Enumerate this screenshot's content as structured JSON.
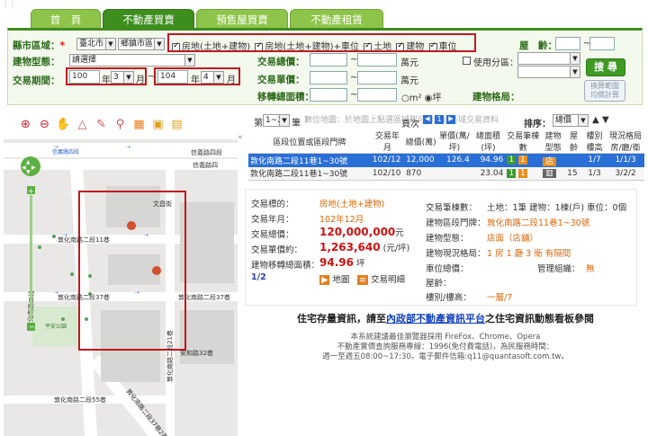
{
  "tabs": [
    {
      "label": "首　頁"
    },
    {
      "label": "不動產買賣"
    },
    {
      "label": "預售屋買賣"
    },
    {
      "label": "不動產租賃"
    }
  ],
  "search": {
    "county_label": "縣市區域：",
    "county_value": "臺北市",
    "district_value": "鄉鎮市區",
    "types": [
      {
        "label": "房地(土地+建物)",
        "checked": true
      },
      {
        "label": "房地(土地+建物)+車位",
        "checked": true
      },
      {
        "label": "土地",
        "checked": true
      },
      {
        "label": "建物",
        "checked": true
      },
      {
        "label": "車位",
        "checked": true
      }
    ],
    "age_label": "屋　齡：",
    "age_sep": "~",
    "btype_label": "建物型態：",
    "btype_value": "請選擇",
    "total_label": "交易總價：",
    "total_sep": "~",
    "total_unit": "萬元",
    "use_label": "使用分區：",
    "period_label": "交易期間：",
    "from_year": "100",
    "year_word": "年",
    "from_month": "3",
    "month_word": "月",
    "to_sep": "~",
    "to_year": "104",
    "to_month": "4",
    "unit_price_label": "交易單價：",
    "unit_sep": "~",
    "unit_unit": "萬元",
    "area_label": "移轉總面積：",
    "area_sep": "~",
    "unit_m2": "m²",
    "unit_ping": "坪",
    "layout_label": "建物格局：",
    "search_btn": "搜 尋",
    "calc_btn1": "換算範圍",
    "calc_btn2": "均價計算"
  },
  "map": {
    "streets": [
      "信義路四段",
      "信義路四",
      "文昌街",
      "敦化南路二段11巷",
      "敦化南路二段37巷",
      "敦化南路二段37巷",
      "敦化南路二段21巷",
      "安和路32巷",
      "敦化南路二段55巷",
      "敦化南路二段37巷2弄",
      "平安公園",
      "敦化南路二段",
      "信義路四段"
    ]
  },
  "results": {
    "page_prefix": "第",
    "page_value": "1~2",
    "page_suffix": "筆",
    "faded": "數位地圖：於地圖上點選區域即可顯示該區域交易資料",
    "page_nav": "頁次",
    "page_num": "1",
    "sort_label": "排序：",
    "sort_value": "總價",
    "headers": [
      "區段位置或區段門牌",
      "交易年月",
      "總價(萬)",
      "單價(萬/坪)",
      "總面積(坪)",
      "交易筆棟數",
      "建物型態",
      "屋齡",
      "樓別樓高",
      "現況格局房/廳/衛"
    ],
    "rows": [
      {
        "addr": "敦化南路二段11巷1~30號",
        "ym": "102/12",
        "total": "12,000",
        "unit": "126.4",
        "area": "94.96",
        "s1": "1",
        "s2": "1",
        "age": "",
        "floor": "1/7",
        "layout": "1/1/3"
      },
      {
        "addr": "敦化南路二段11巷1~30號",
        "ym": "102/10",
        "total": "870",
        "unit": "",
        "area": "23.04",
        "s1": "1",
        "s2": "1",
        "age": "15",
        "floor": "1/3",
        "layout": "3/2/2"
      }
    ]
  },
  "detail": {
    "target_label": "交易標的：",
    "target_value": "房地(土地+建物)",
    "ym_label": "交易年月：",
    "ym_value": "102年12月",
    "total_label": "交易總價：",
    "total_value": "120,000,000",
    "total_unit": "元",
    "unit_label": "交易單價約：",
    "unit_value": "1,263,640",
    "unit_unit": "(元/坪)",
    "area_label": "建物移轉總面積：",
    "area_value": "94.96",
    "area_unit": "坪",
    "page_label": "1/2",
    "map_btn": "地圖",
    "detail_btn": "交易明細",
    "count_label": "交易筆棟數：",
    "count_value": "土地：1筆 建物：1棟(戶) 車位：0個",
    "addr_label": "建物區段門牌：",
    "addr_value": "敦化南路二段11巷1~30號",
    "btype_label": "建物型態：",
    "btype_value": "店面（店舖）",
    "layout_label": "建物現況格局：",
    "layout_value": "1 房 1 廳 3 衛 有隔間",
    "parking_label": "車位總價：",
    "mgmt_label": "管理組織：",
    "mgmt_value": "無",
    "age_label": "屋齡：",
    "floor_label": "樓別/樓高：",
    "floor_value": "一層/7"
  },
  "notice": {
    "pre": "住宅存量資訊，請至",
    "link": "內政部不動產資訊平台",
    "post": "之住宅資訊動態看板參閱"
  },
  "footer": [
    "本系統建議最佳瀏覽器採用 FireFox、Chrome、Opera",
    "不動產實價查詢服務專線：1996(免付費電話)，為民服務時間：",
    "週一至週五08:00~17:30。電子郵件信箱:q11@quantasoft.com.tw。"
  ]
}
